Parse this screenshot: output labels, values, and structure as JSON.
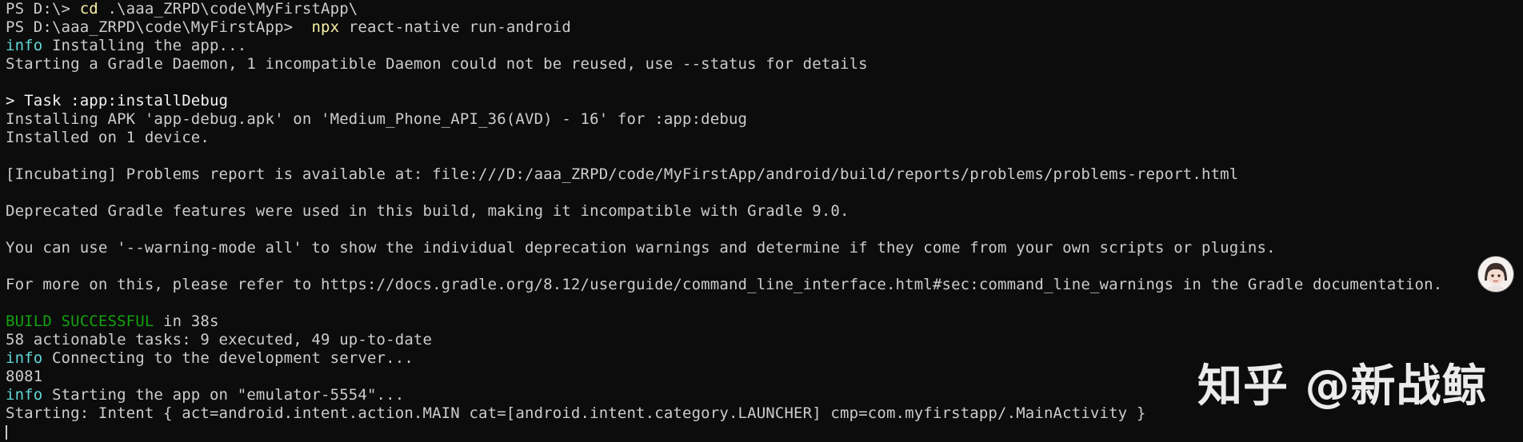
{
  "terminal": {
    "lines": [
      {
        "prompt": "PS D:\\> ",
        "cmd": "cd",
        "args": " .\\aaa_ZRPD\\code\\MyFirstApp\\"
      },
      {
        "prompt": "PS D:\\aaa_ZRPD\\code\\MyFirstApp>  ",
        "cmd": "npx",
        "args": " react-native run-android"
      },
      {
        "tag": "info",
        "text": " Installing the app..."
      },
      {
        "text": "Starting a Gradle Daemon, 1 incompatible Daemon could not be reused, use --status for details"
      },
      {
        "text": ""
      },
      {
        "text": "> Task :app:installDebug"
      },
      {
        "text": "Installing APK 'app-debug.apk' on 'Medium_Phone_API_36(AVD) - 16' for :app:debug"
      },
      {
        "text": "Installed on 1 device."
      },
      {
        "text": ""
      },
      {
        "text": "[Incubating] Problems report is available at: file:///D:/aaa_ZRPD/code/MyFirstApp/android/build/reports/problems/problems-report.html"
      },
      {
        "text": ""
      },
      {
        "text": "Deprecated Gradle features were used in this build, making it incompatible with Gradle 9.0."
      },
      {
        "text": ""
      },
      {
        "text": "You can use '--warning-mode all' to show the individual deprecation warnings and determine if they come from your own scripts or plugins."
      },
      {
        "text": ""
      },
      {
        "text": "For more on this, please refer to https://docs.gradle.org/8.12/userguide/command_line_interface.html#sec:command_line_warnings in the Gradle documentation."
      },
      {
        "text": ""
      },
      {
        "success": "BUILD SUCCESSFUL",
        "text": " in 38s"
      },
      {
        "text": "58 actionable tasks: 9 executed, 49 up-to-date"
      },
      {
        "tag": "info",
        "text": " Connecting to the development server..."
      },
      {
        "text": "8081"
      },
      {
        "tag": "info",
        "text": " Starting the app on \"emulator-5554\"..."
      },
      {
        "text": "Starting: Intent { act=android.intent.action.MAIN cat=[android.intent.category.LAUNCHER] cmp=com.myfirstapp/.MainActivity }"
      }
    ]
  },
  "watermark": {
    "text": "知乎 @新战鲸"
  },
  "colors": {
    "background": "#0c0c0c",
    "text": "#cccccc",
    "info": "#61d6d6",
    "success": "#13a10e",
    "command": "#f9f1a5"
  }
}
